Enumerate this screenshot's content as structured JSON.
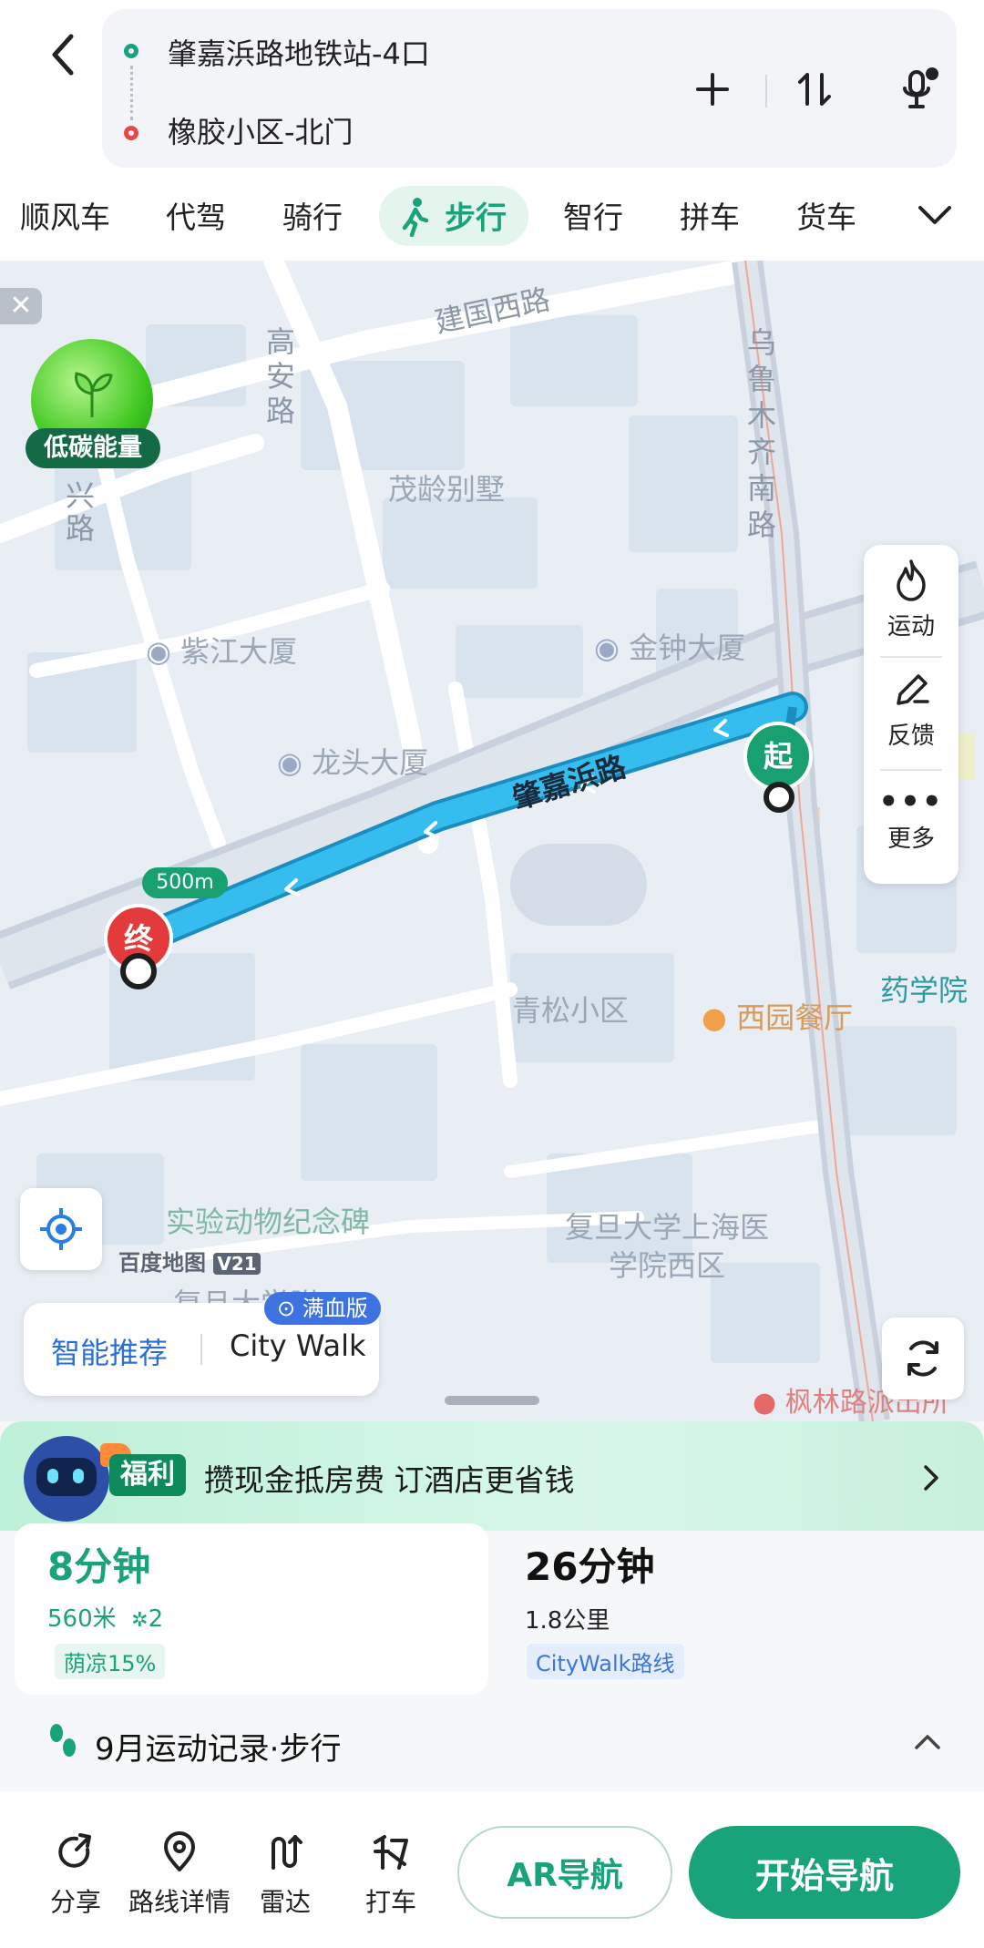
{
  "header": {
    "origin": "肇嘉浜路地铁站-4口",
    "destination": "橡胶小区-北门"
  },
  "modes": [
    "顺风车",
    "代驾",
    "骑行",
    "步行",
    "智行",
    "拼车",
    "货车"
  ],
  "active_mode": "步行",
  "map": {
    "roads": [
      "建国西路",
      "高安路",
      "乌鲁木齐南路",
      "肇嘉浜路",
      "兴路"
    ],
    "pois": [
      "茂龄别墅",
      "紫江大厦",
      "金钟大厦",
      "龙头大厦",
      "青松小区",
      "西园餐厅",
      "药学院",
      "实验动物纪念碑",
      "复旦大学上海医学院西区",
      "枫林路派出所",
      "复旦大学附"
    ],
    "badge_low_carbon": "低碳能量",
    "start_marker": "起",
    "end_marker": "终",
    "scale": "500m",
    "brand": "百度地图",
    "version": "V21",
    "side_menu": [
      "运动",
      "反馈",
      "更多"
    ],
    "route_tabs": [
      "智能推荐",
      "City Walk"
    ],
    "route_tab_badge": "满血版"
  },
  "promo": {
    "tag": "福利",
    "text": "攒现金抵房费 订酒店更省钱"
  },
  "routes": [
    {
      "time": "8分钟",
      "distance": "560米",
      "lights": "2",
      "tag": "荫凉15%"
    },
    {
      "time": "26分钟",
      "distance": "1.8公里",
      "tag": "CityWalk路线"
    }
  ],
  "record": "9月运动记录·步行",
  "bottom_actions": [
    "分享",
    "路线详情",
    "雷达",
    "打车"
  ],
  "ar_button": "AR导航",
  "start_button": "开始导航",
  "colors": {
    "accent": "#19a37a",
    "route": "#2fb7ea",
    "end": "#e33b3b"
  }
}
